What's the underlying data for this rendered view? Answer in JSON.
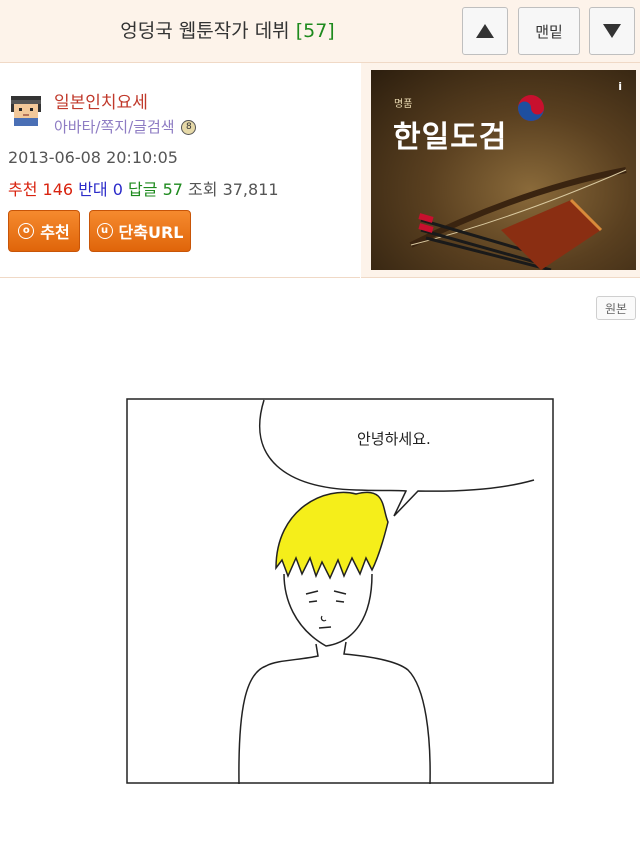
{
  "header": {
    "title": "엉덩국 웹툰작가 데뷔",
    "count": "[57]",
    "bottom_label": "맨밑"
  },
  "author": {
    "nickname": "일본인치요세",
    "link_avatar": "아바타",
    "link_message": "쪽지",
    "link_search": "글검색",
    "date": "2013-06-08 20:10:05",
    "recommend_label": "추천",
    "recommend_value": "146",
    "oppose_label": "반대",
    "oppose_value": "0",
    "reply_label": "답글",
    "reply_value": "57",
    "view_label": "조회",
    "view_value": "37,811",
    "btn_recommend": "추천",
    "btn_short_url": "단축URL"
  },
  "ad": {
    "small_text": "명품",
    "brand": "한일도검",
    "info": "i"
  },
  "content": {
    "original_button": "원본",
    "speech": "안녕하세요."
  },
  "colors": {
    "accent_orange": "#e0650a",
    "recommend_red": "#d9230f",
    "oppose_blue": "#2b2bc9",
    "reply_green": "#1e8a1e",
    "hair_yellow": "#f5ee1a"
  }
}
